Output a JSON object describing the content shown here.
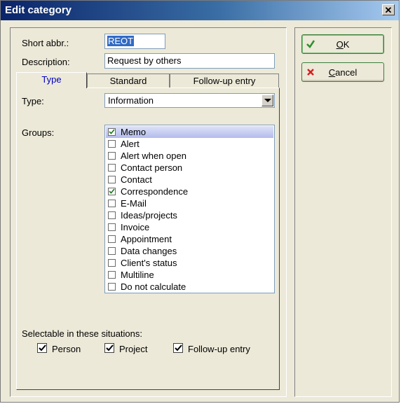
{
  "window": {
    "title": "Edit category",
    "close_glyph": "✕"
  },
  "form": {
    "short_abbr_label": "Short abbr.:",
    "short_abbr_value": "REOT",
    "description_label": "Description:",
    "description_value": "Request by others"
  },
  "tabs": [
    "Type",
    "Standard",
    "Follow-up entry"
  ],
  "active_tab": "Type",
  "type_tab": {
    "type_label": "Type:",
    "type_value": "Information",
    "groups_label": "Groups:",
    "groups": [
      {
        "label": "Memo",
        "checked": true,
        "selected": true
      },
      {
        "label": "Alert",
        "checked": false
      },
      {
        "label": "Alert when open",
        "checked": false
      },
      {
        "label": "Contact person",
        "checked": false
      },
      {
        "label": "Contact",
        "checked": false
      },
      {
        "label": "Correspondence",
        "checked": true
      },
      {
        "label": "E-Mail",
        "checked": false
      },
      {
        "label": "Ideas/projects",
        "checked": false
      },
      {
        "label": "Invoice",
        "checked": false
      },
      {
        "label": "Appointment",
        "checked": false
      },
      {
        "label": "Data changes",
        "checked": false
      },
      {
        "label": "Client's status",
        "checked": false
      },
      {
        "label": "Multiline",
        "checked": false
      },
      {
        "label": "Do not calculate",
        "checked": false
      }
    ],
    "selectable_label": "Selectable in these situations:",
    "situations": [
      {
        "label": "Person",
        "checked": true
      },
      {
        "label": "Project",
        "checked": true
      },
      {
        "label": "Follow-up entry",
        "checked": true
      }
    ]
  },
  "buttons": {
    "ok": {
      "mnemonic": "O",
      "rest": "K",
      "icon": "checkmark-icon",
      "icon_color": "#2f8f2f"
    },
    "cancel": {
      "mnemonic": "C",
      "rest": "ancel",
      "icon": "cross-icon",
      "icon_color": "#d42020"
    }
  },
  "colors": {
    "title_bar": "#0a246a",
    "selection": "#316ac5",
    "active_tab_text": "#0000c0"
  }
}
